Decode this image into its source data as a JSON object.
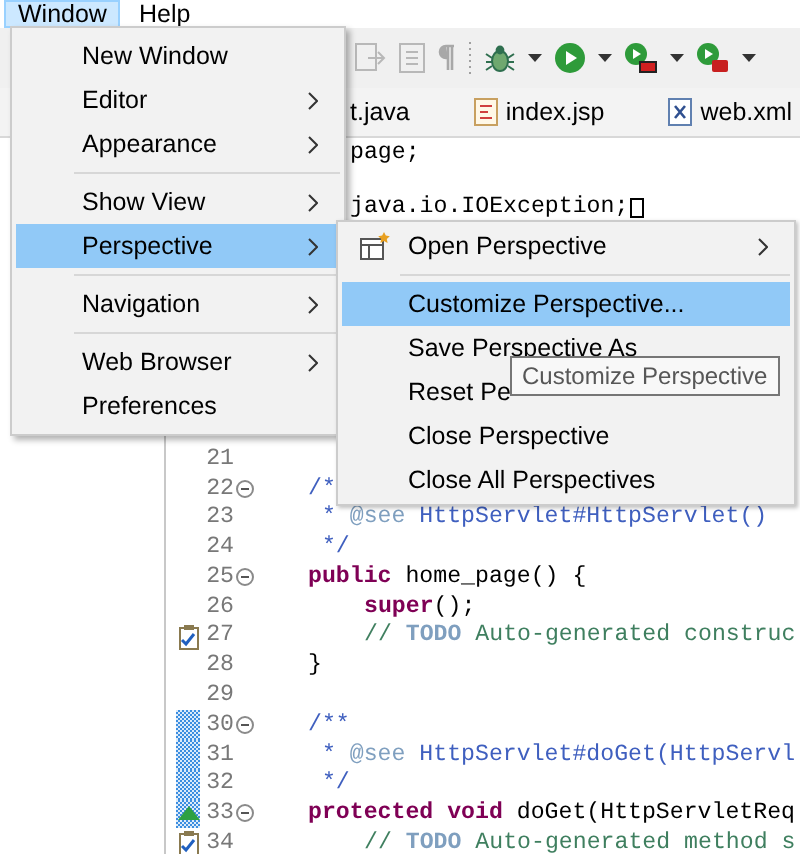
{
  "menubar": [
    {
      "label": "Window",
      "selected": true
    },
    {
      "label": "Help",
      "selected": false
    }
  ],
  "editor_tabs": [
    {
      "label": "t.java",
      "kind": "java"
    },
    {
      "label": "index.jsp",
      "kind": "jsp"
    },
    {
      "label": "web.xml",
      "kind": "xml"
    }
  ],
  "top_fragments": [
    {
      "text": "page;"
    },
    {
      "text": "java.io.IOException;",
      "unresolved_box": true
    }
  ],
  "code_lines": [
    {
      "number": "21"
    },
    {
      "number": "22",
      "fold": true,
      "tokens": [
        {
          "text": "/*",
          "kind": "javadoc"
        }
      ]
    },
    {
      "number": "23",
      "tokens": [
        {
          "text": " * ",
          "kind": "javadoc"
        },
        {
          "text": "@see",
          "kind": "tag"
        },
        {
          "text": " HttpServlet#HttpServlet()",
          "kind": "javadoc"
        }
      ]
    },
    {
      "number": "24",
      "tokens": [
        {
          "text": " */",
          "kind": "javadoc"
        }
      ]
    },
    {
      "number": "25",
      "fold": true,
      "tokens": [
        {
          "text": "public",
          "kind": "keyword"
        },
        {
          "text": " home_page() {",
          "kind": "plain"
        }
      ]
    },
    {
      "number": "26",
      "indent": true,
      "tokens": [
        {
          "text": "super",
          "kind": "keyword"
        },
        {
          "text": "();",
          "kind": "plain"
        }
      ]
    },
    {
      "number": "27",
      "task": true,
      "indent": true,
      "tokens": [
        {
          "text": "// ",
          "kind": "comment"
        },
        {
          "text": "TODO",
          "kind": "todo"
        },
        {
          "text": " Auto-generated construc",
          "kind": "comment"
        }
      ]
    },
    {
      "number": "28",
      "tokens": [
        {
          "text": "}",
          "kind": "plain"
        }
      ]
    },
    {
      "number": "29"
    },
    {
      "number": "30",
      "fold": true,
      "changed": true,
      "tokens": [
        {
          "text": "/**",
          "kind": "javadoc"
        }
      ]
    },
    {
      "number": "31",
      "changed": true,
      "tokens": [
        {
          "text": " * ",
          "kind": "javadoc"
        },
        {
          "text": "@see",
          "kind": "tag"
        },
        {
          "text": " HttpServlet#doGet(HttpServl",
          "kind": "javadoc"
        }
      ]
    },
    {
      "number": "32",
      "changed": true,
      "tokens": [
        {
          "text": " */",
          "kind": "javadoc"
        }
      ]
    },
    {
      "number": "33",
      "fold": true,
      "changed": true,
      "override": true,
      "tokens": [
        {
          "text": "protected void",
          "kind": "keyword"
        },
        {
          "text": " doGet(HttpServletReq",
          "kind": "plain"
        }
      ]
    },
    {
      "number": "34",
      "task": true,
      "indent": true,
      "tokens": [
        {
          "text": "// ",
          "kind": "comment"
        },
        {
          "text": "TODO",
          "kind": "todo"
        },
        {
          "text": " Auto-generated method s",
          "kind": "comment"
        }
      ]
    }
  ],
  "window_menu": [
    {
      "kind": "item",
      "label": "New Window",
      "submenu": false,
      "selected": false
    },
    {
      "kind": "item",
      "label": "Editor",
      "submenu": true,
      "selected": false
    },
    {
      "kind": "item",
      "label": "Appearance",
      "submenu": true,
      "selected": false
    },
    {
      "kind": "separator"
    },
    {
      "kind": "item",
      "label": "Show View",
      "submenu": true,
      "selected": false
    },
    {
      "kind": "item",
      "label": "Perspective",
      "submenu": true,
      "selected": true
    },
    {
      "kind": "separator"
    },
    {
      "kind": "item",
      "label": "Navigation",
      "submenu": true,
      "selected": false
    },
    {
      "kind": "separator"
    },
    {
      "kind": "item",
      "label": "Web Browser",
      "submenu": true,
      "selected": false
    },
    {
      "kind": "item",
      "label": "Preferences",
      "submenu": false,
      "selected": false
    }
  ],
  "perspective_menu": [
    {
      "kind": "item",
      "label": "Open Perspective",
      "submenu": true,
      "selected": false,
      "icon": true
    },
    {
      "kind": "separator"
    },
    {
      "kind": "item",
      "label": "Customize Perspective...",
      "submenu": false,
      "selected": true,
      "icon": false
    },
    {
      "kind": "item",
      "label": "Save Perspective As",
      "submenu": false,
      "selected": false,
      "icon": false
    },
    {
      "kind": "item",
      "label": "Reset Pe",
      "submenu": false,
      "selected": false,
      "icon": false
    },
    {
      "kind": "item",
      "label": "Close Perspective",
      "submenu": false,
      "selected": false,
      "icon": false
    },
    {
      "kind": "item",
      "label": "Close All Perspectives",
      "submenu": false,
      "selected": false,
      "icon": false
    }
  ],
  "tooltip": {
    "text": "Customize Perspective"
  }
}
